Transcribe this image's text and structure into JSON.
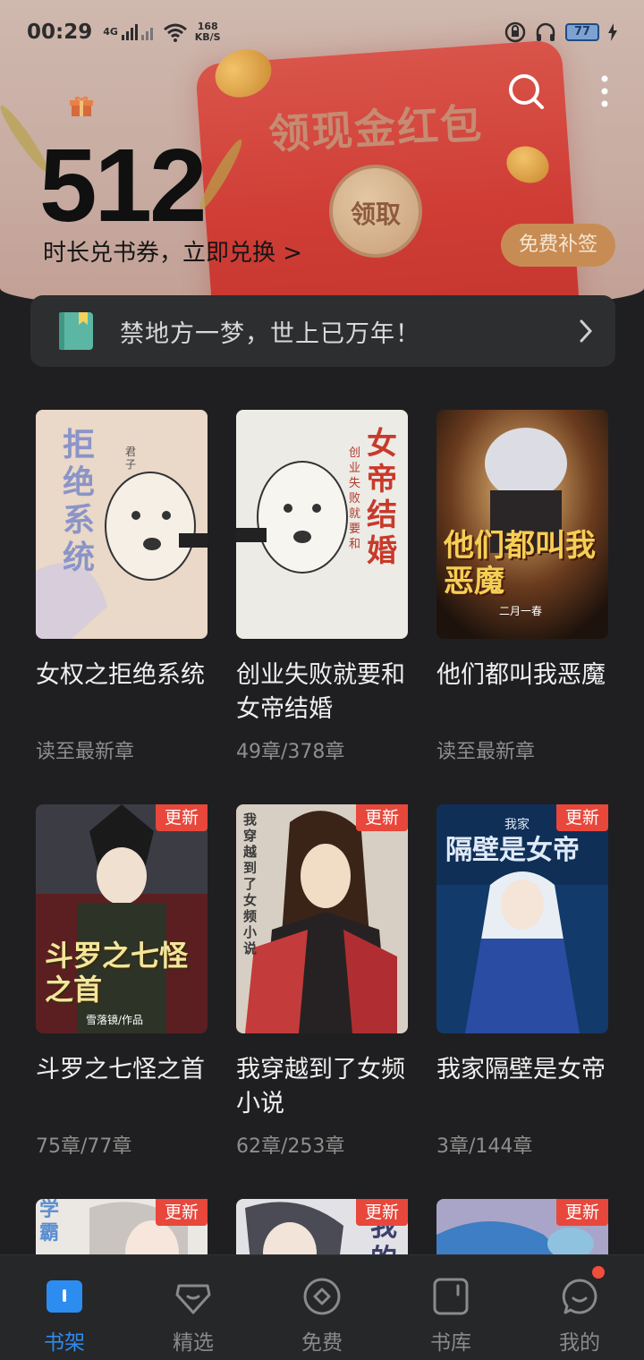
{
  "status_bar": {
    "time": "00:29",
    "signal": "4G",
    "net_speed_value": "168",
    "net_speed_unit": "KB/S",
    "battery": "77"
  },
  "header": {
    "balance": "512",
    "exchange_text": "时长兑书券，立即兑换 >",
    "promo_title": "领现金红包",
    "promo_claim": "领取",
    "checkin_label": "免费补签"
  },
  "quote": {
    "text": "禁地方一梦，世上已万年！"
  },
  "books": [
    {
      "title": "女权之拒绝系统",
      "progress": "读至最新章",
      "badge": ""
    },
    {
      "title": "创业失败就要和女帝结婚",
      "progress": "49章/378章",
      "badge": ""
    },
    {
      "title": "他们都叫我恶魔",
      "progress": "读至最新章",
      "badge": ""
    },
    {
      "title": "斗罗之七怪之首",
      "progress": "75章/77章",
      "badge": "更新"
    },
    {
      "title": "我穿越到了女频小说",
      "progress": "62章/253章",
      "badge": "更新"
    },
    {
      "title": "我家隔壁是女帝",
      "progress": "3章/144章",
      "badge": "更新"
    },
    {
      "title": "",
      "progress": "",
      "badge": "更新"
    },
    {
      "title": "",
      "progress": "",
      "badge": "更新"
    },
    {
      "title": "",
      "progress": "",
      "badge": "更新"
    }
  ],
  "covers": [
    {
      "main": "拒绝系统",
      "sub": "君子"
    },
    {
      "main": "女帝结婚",
      "sub": "创业失败就要和"
    },
    {
      "main": "他们都叫我恶魔",
      "sub": "二月一春"
    },
    {
      "main": "斗罗之七怪之首",
      "sub": "雪落镜/作品"
    },
    {
      "main": "我穿越到了女频小说",
      "sub": ""
    },
    {
      "main": "隔壁是女帝",
      "sub": "我家"
    },
    {
      "main": "学霸",
      "sub": ""
    },
    {
      "main": "我的",
      "sub": ""
    },
    {
      "main": "",
      "sub": ""
    }
  ],
  "nav": [
    {
      "label": "书架",
      "icon": "bookshelf-icon",
      "active": true
    },
    {
      "label": "精选",
      "icon": "diamond-icon",
      "active": false
    },
    {
      "label": "免费",
      "icon": "free-icon",
      "active": false
    },
    {
      "label": "书库",
      "icon": "library-icon",
      "active": false
    },
    {
      "label": "我的",
      "icon": "profile-icon",
      "active": false
    }
  ],
  "colors": {
    "accent": "#2d8cf0",
    "badge": "#e8473b",
    "background": "#1f1f21"
  }
}
